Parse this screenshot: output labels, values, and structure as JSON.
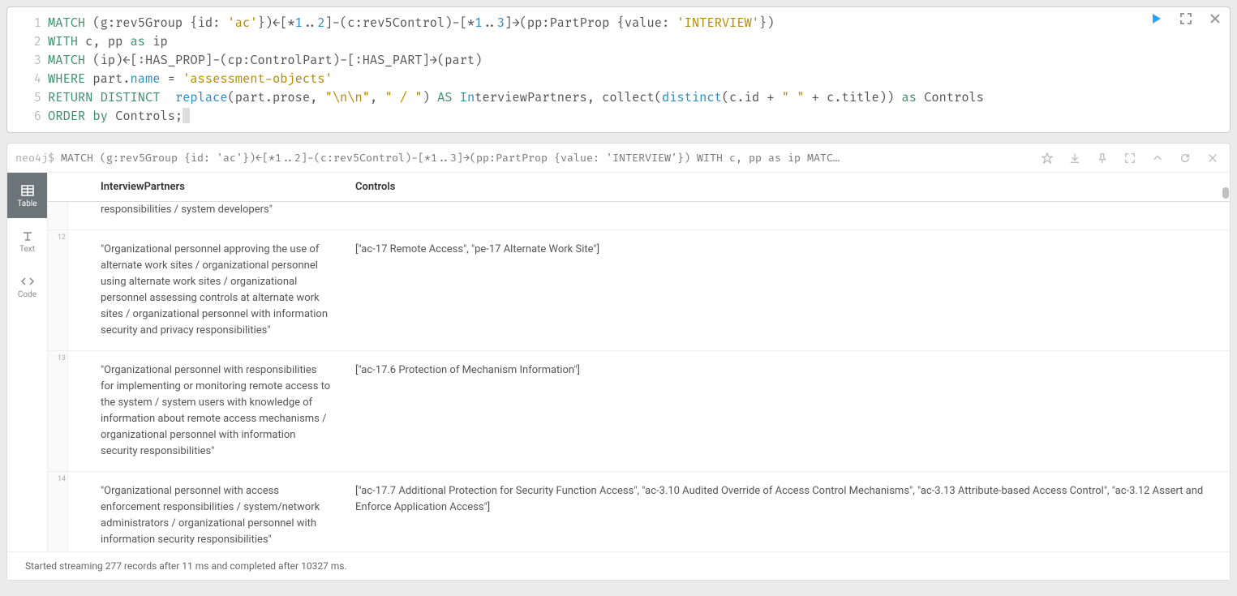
{
  "editor": {
    "line_numbers": [
      "1",
      "2",
      "3",
      "4",
      "5",
      "6"
    ],
    "tokens": {
      "l1": {
        "k_match": "MATCH",
        "t1": " (g:rev5Group {id: ",
        "s_ac": "'ac'",
        "t2": "})←[*",
        "n1": "1",
        "dots1": "..",
        "n2": "2",
        "t3": "]-(c:rev5Control)-[*",
        "n3": "1",
        "dots2": "..",
        "n4": "3",
        "t4": "]→(pp:PartProp {value: ",
        "s_int": "'INTERVIEW'",
        "t5": "})"
      },
      "l2": {
        "k_with": "WITH",
        "t1": " c, pp ",
        "k_as": "as",
        "t2": " ip"
      },
      "l3": {
        "k_match": "MATCH",
        "t1": " (ip)←[:HAS_PROP]-(cp:ControlPart)-[:HAS_PART]→(part)"
      },
      "l4": {
        "k_where": "WHERE",
        "t1": " part.",
        "p_name": "name",
        "t2": " = ",
        "s_ao": "'assessment-objects'"
      },
      "l5": {
        "k_return": "RETURN",
        "k_distinct": "DISTINCT",
        "sp": "  ",
        "f_replace": "replace",
        "t1": "(part.prose, ",
        "s_nn": "\"\\n\\n\"",
        "t2": ", ",
        "s_slash": "\" / \"",
        "t3": ") ",
        "k_as1": "AS",
        "t_in": " In",
        "t4": "terviewPartners, collect(",
        "f_distinct": "distinct",
        "t5": "(c.id + ",
        "s_sp": "\" \"",
        "t6": " + c.title)) ",
        "k_as2": "as",
        "t7": " Controls"
      },
      "l6": {
        "k_order": "ORDER",
        "k_by": "by",
        "t1": " Controls;"
      }
    }
  },
  "result_header": {
    "prompt": "neo4j$",
    "query": "MATCH (g:rev5Group {id: 'ac'})←[*1..2]-(c:rev5Control)-[*1..3]→(pp:PartProp {value: 'INTERVIEW'}) WITH c, pp as ip MATC…"
  },
  "side_tabs": {
    "table": "Table",
    "text": "Text",
    "code": "Code"
  },
  "columns": {
    "ip": "InterviewPartners",
    "ctrl": "Controls"
  },
  "rows": [
    {
      "num": "",
      "ip": "responsibilities / system developers\"",
      "ctrl": "",
      "partial": true
    },
    {
      "num": "12",
      "ip": "\"Organizational personnel approving the use of alternate work sites / organizational personnel using alternate work sites / organizational personnel assessing controls at alternate work sites / organizational personnel with information security and privacy responsibilities\"",
      "ctrl": "[\"ac-17 Remote Access\", \"pe-17 Alternate Work Site\"]"
    },
    {
      "num": "13",
      "ip": "\"Organizational personnel with responsibilities for implementing or monitoring remote access to the system / system users with knowledge of information about remote access mechanisms / organizational personnel with information security responsibilities\"",
      "ctrl": "[\"ac-17.6 Protection of Mechanism Information\"]"
    },
    {
      "num": "14",
      "ip": "\"Organizational personnel with access enforcement responsibilities / system/network administrators / organizational personnel with information security responsibilities\"",
      "ctrl": "[\"ac-17.7 Additional Protection for Security Function Access\", \"ac-3.10 Audited Override of Access Control Mechanisms\", \"ac-3.13 Attribute-based Access Control\", \"ac-3.12 Assert and Enforce Application Access\"]"
    }
  ],
  "status": "Started streaming 277 records after 11 ms and completed after 10327 ms."
}
